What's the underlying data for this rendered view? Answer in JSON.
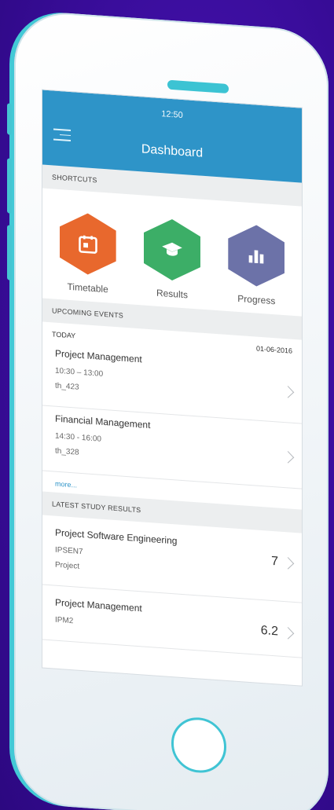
{
  "status_time": "12:50",
  "title": "Dashboard",
  "sections": {
    "shortcuts": "SHORTCUTS",
    "upcoming": "UPCOMING EVENTS",
    "results": "LATEST STUDY RESULTS"
  },
  "shortcuts": [
    {
      "label": "Timetable",
      "icon": "calendar-icon",
      "color": "#e8682d"
    },
    {
      "label": "Results",
      "icon": "graduation-cap-icon",
      "color": "#3cae67"
    },
    {
      "label": "Progress",
      "icon": "bar-chart-icon",
      "color": "#6c72a8"
    }
  ],
  "events": {
    "day_label": "TODAY",
    "date": "01-06-2016",
    "items": [
      {
        "title": "Project Management",
        "time": "10:30 – 13:00",
        "room": "th_423"
      },
      {
        "title": "Financial Management",
        "time": "14:30 - 16:00",
        "room": "th_328"
      }
    ],
    "more": "more..."
  },
  "results": [
    {
      "title": "Project Software Engineering",
      "code": "IPSEN7",
      "type": "Project",
      "grade": "7"
    },
    {
      "title": "Project Management",
      "code": "IPM2",
      "type": "",
      "grade": "6.2"
    }
  ],
  "colors": {
    "accent": "#2e94c8",
    "phone_edge": "#43c9d6",
    "background": "#3d0fa3"
  }
}
